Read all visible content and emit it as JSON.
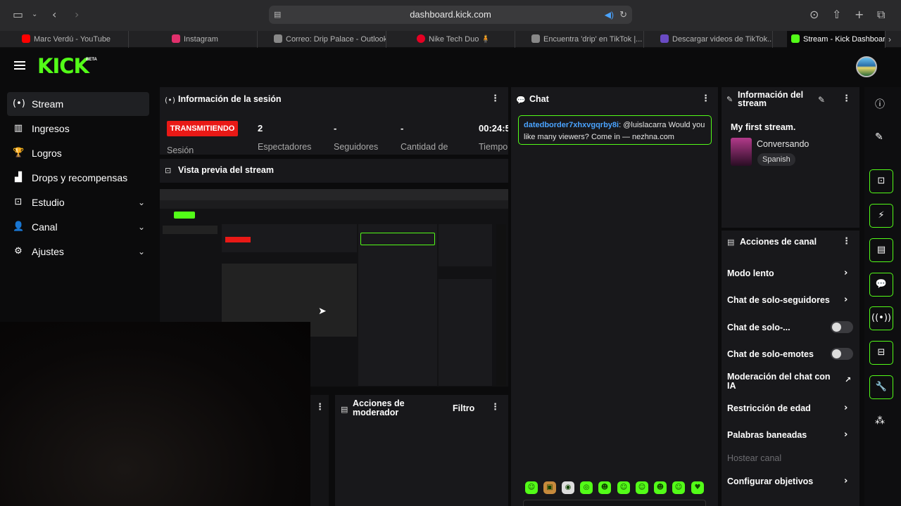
{
  "browser": {
    "url": "dashboard.kick.com",
    "tabs": [
      {
        "label": "Marc Verdú - YouTube",
        "color": "#ff0000"
      },
      {
        "label": "Instagram",
        "color": "#e1306c"
      },
      {
        "label": "Correo: Drip Palace - Outlook",
        "color": "#888888"
      },
      {
        "label": "Nike Tech Duo 🧍",
        "color": "#e60023"
      },
      {
        "label": "Encuentra 'drip' en TikTok |...",
        "color": "#888888"
      },
      {
        "label": "Descargar videos de TikTok...",
        "color": "#6a4bc4"
      },
      {
        "label": "Stream - Kick Dashboard",
        "color": "#53fc18"
      }
    ]
  },
  "header": {
    "logo": "KICK",
    "beta": "BETA"
  },
  "sidebar": {
    "items": [
      {
        "label": "Stream",
        "icon": "(•)"
      },
      {
        "label": "Ingresos",
        "icon": "▥"
      },
      {
        "label": "Logros",
        "icon": "🏆"
      },
      {
        "label": "Drops y recompensas",
        "icon": "▟"
      },
      {
        "label": "Estudio",
        "icon": "⊡"
      },
      {
        "label": "Canal",
        "icon": "👤"
      },
      {
        "label": "Ajustes",
        "icon": "⚙"
      }
    ],
    "chevron": "⌄"
  },
  "session": {
    "title": "Información de la sesión",
    "status": "TRANSMITIENDO",
    "status_label": "Sesión",
    "stats": [
      {
        "value": "2",
        "label": "Espectadores"
      },
      {
        "value": "-",
        "label": "Seguidores"
      },
      {
        "value": "-",
        "label": "Cantidad de"
      },
      {
        "value": "00:24:5",
        "label": "Tiempo"
      }
    ]
  },
  "preview": {
    "title": "Vista previa del stream"
  },
  "moderators": {
    "title": "Acciones de moderador",
    "filter": "Filtro"
  },
  "chat": {
    "title": "Chat",
    "messages": [
      {
        "user": "datedborder7xhxvgqrby8i",
        "text": "@luislacarra Would you like many viewers? Come in — nezhna.com"
      }
    ],
    "emotes": [
      "☺",
      "▣",
      "◉",
      "◎",
      "☻",
      "☺",
      "☺",
      "☻",
      "☺",
      "☺",
      "♥"
    ]
  },
  "stream_info": {
    "title": "Información del stream",
    "stream_title": "My first stream.",
    "category": "Conversando",
    "language": "Spanish"
  },
  "channel_actions": {
    "title": "Acciones de canal",
    "items": [
      {
        "label": "Modo lento",
        "control": "arrow"
      },
      {
        "label": "Chat de solo-seguidores",
        "control": "arrow"
      },
      {
        "label": "Chat de solo-...",
        "control": "toggle"
      },
      {
        "label": "Chat de solo-emotes",
        "control": "toggle"
      },
      {
        "label": "Moderación del chat con IA",
        "control": "external"
      },
      {
        "label": "Restricción de edad",
        "control": "arrow"
      },
      {
        "label": "Palabras baneadas",
        "control": "arrow"
      },
      {
        "label": "Hostear canal",
        "control": "none"
      },
      {
        "label": "Configurar objetivos",
        "control": "arrow"
      }
    ]
  },
  "right_rail": [
    "info-icon",
    "edit-icon",
    "screen-icon",
    "lightning-icon",
    "notes-icon",
    "chat-icon",
    "broadcast-icon",
    "layout-icon",
    "wrench-icon",
    "dots-icon"
  ]
}
